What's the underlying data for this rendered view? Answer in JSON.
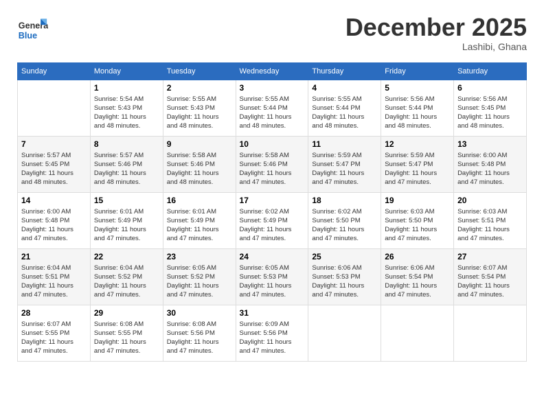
{
  "header": {
    "logo_line1": "General",
    "logo_line2": "Blue",
    "month": "December 2025",
    "location": "Lashibi, Ghana"
  },
  "weekdays": [
    "Sunday",
    "Monday",
    "Tuesday",
    "Wednesday",
    "Thursday",
    "Friday",
    "Saturday"
  ],
  "weeks": [
    [
      {
        "day": "",
        "info": ""
      },
      {
        "day": "1",
        "info": "Sunrise: 5:54 AM\nSunset: 5:43 PM\nDaylight: 11 hours\nand 48 minutes."
      },
      {
        "day": "2",
        "info": "Sunrise: 5:55 AM\nSunset: 5:43 PM\nDaylight: 11 hours\nand 48 minutes."
      },
      {
        "day": "3",
        "info": "Sunrise: 5:55 AM\nSunset: 5:44 PM\nDaylight: 11 hours\nand 48 minutes."
      },
      {
        "day": "4",
        "info": "Sunrise: 5:55 AM\nSunset: 5:44 PM\nDaylight: 11 hours\nand 48 minutes."
      },
      {
        "day": "5",
        "info": "Sunrise: 5:56 AM\nSunset: 5:44 PM\nDaylight: 11 hours\nand 48 minutes."
      },
      {
        "day": "6",
        "info": "Sunrise: 5:56 AM\nSunset: 5:45 PM\nDaylight: 11 hours\nand 48 minutes."
      }
    ],
    [
      {
        "day": "7",
        "info": "Sunrise: 5:57 AM\nSunset: 5:45 PM\nDaylight: 11 hours\nand 48 minutes."
      },
      {
        "day": "8",
        "info": "Sunrise: 5:57 AM\nSunset: 5:46 PM\nDaylight: 11 hours\nand 48 minutes."
      },
      {
        "day": "9",
        "info": "Sunrise: 5:58 AM\nSunset: 5:46 PM\nDaylight: 11 hours\nand 48 minutes."
      },
      {
        "day": "10",
        "info": "Sunrise: 5:58 AM\nSunset: 5:46 PM\nDaylight: 11 hours\nand 47 minutes."
      },
      {
        "day": "11",
        "info": "Sunrise: 5:59 AM\nSunset: 5:47 PM\nDaylight: 11 hours\nand 47 minutes."
      },
      {
        "day": "12",
        "info": "Sunrise: 5:59 AM\nSunset: 5:47 PM\nDaylight: 11 hours\nand 47 minutes."
      },
      {
        "day": "13",
        "info": "Sunrise: 6:00 AM\nSunset: 5:48 PM\nDaylight: 11 hours\nand 47 minutes."
      }
    ],
    [
      {
        "day": "14",
        "info": "Sunrise: 6:00 AM\nSunset: 5:48 PM\nDaylight: 11 hours\nand 47 minutes."
      },
      {
        "day": "15",
        "info": "Sunrise: 6:01 AM\nSunset: 5:49 PM\nDaylight: 11 hours\nand 47 minutes."
      },
      {
        "day": "16",
        "info": "Sunrise: 6:01 AM\nSunset: 5:49 PM\nDaylight: 11 hours\nand 47 minutes."
      },
      {
        "day": "17",
        "info": "Sunrise: 6:02 AM\nSunset: 5:49 PM\nDaylight: 11 hours\nand 47 minutes."
      },
      {
        "day": "18",
        "info": "Sunrise: 6:02 AM\nSunset: 5:50 PM\nDaylight: 11 hours\nand 47 minutes."
      },
      {
        "day": "19",
        "info": "Sunrise: 6:03 AM\nSunset: 5:50 PM\nDaylight: 11 hours\nand 47 minutes."
      },
      {
        "day": "20",
        "info": "Sunrise: 6:03 AM\nSunset: 5:51 PM\nDaylight: 11 hours\nand 47 minutes."
      }
    ],
    [
      {
        "day": "21",
        "info": "Sunrise: 6:04 AM\nSunset: 5:51 PM\nDaylight: 11 hours\nand 47 minutes."
      },
      {
        "day": "22",
        "info": "Sunrise: 6:04 AM\nSunset: 5:52 PM\nDaylight: 11 hours\nand 47 minutes."
      },
      {
        "day": "23",
        "info": "Sunrise: 6:05 AM\nSunset: 5:52 PM\nDaylight: 11 hours\nand 47 minutes."
      },
      {
        "day": "24",
        "info": "Sunrise: 6:05 AM\nSunset: 5:53 PM\nDaylight: 11 hours\nand 47 minutes."
      },
      {
        "day": "25",
        "info": "Sunrise: 6:06 AM\nSunset: 5:53 PM\nDaylight: 11 hours\nand 47 minutes."
      },
      {
        "day": "26",
        "info": "Sunrise: 6:06 AM\nSunset: 5:54 PM\nDaylight: 11 hours\nand 47 minutes."
      },
      {
        "day": "27",
        "info": "Sunrise: 6:07 AM\nSunset: 5:54 PM\nDaylight: 11 hours\nand 47 minutes."
      }
    ],
    [
      {
        "day": "28",
        "info": "Sunrise: 6:07 AM\nSunset: 5:55 PM\nDaylight: 11 hours\nand 47 minutes."
      },
      {
        "day": "29",
        "info": "Sunrise: 6:08 AM\nSunset: 5:55 PM\nDaylight: 11 hours\nand 47 minutes."
      },
      {
        "day": "30",
        "info": "Sunrise: 6:08 AM\nSunset: 5:56 PM\nDaylight: 11 hours\nand 47 minutes."
      },
      {
        "day": "31",
        "info": "Sunrise: 6:09 AM\nSunset: 5:56 PM\nDaylight: 11 hours\nand 47 minutes."
      },
      {
        "day": "",
        "info": ""
      },
      {
        "day": "",
        "info": ""
      },
      {
        "day": "",
        "info": ""
      }
    ]
  ]
}
